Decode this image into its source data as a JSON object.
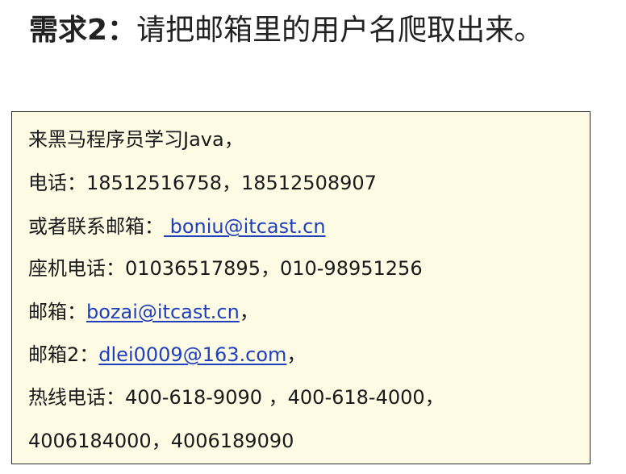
{
  "heading": {
    "label": "需求2：",
    "text": "请把邮箱里的用户名爬取出来。"
  },
  "card": {
    "lines": [
      {
        "text": "来黑马程序员学习Java，"
      },
      {
        "text": "电话：18512516758，18512508907"
      },
      {
        "prefix": "或者联系邮箱：",
        "link": " boniu@itcast.cn",
        "suffix": ""
      },
      {
        "text": "座机电话：01036517895，010-98951256"
      },
      {
        "prefix": "邮箱：",
        "link": "bozai@itcast.cn",
        "suffix": "，"
      },
      {
        "prefix": "邮箱2：",
        "link": "dlei0009@163.com",
        "suffix": "，"
      },
      {
        "text": "热线电话：400-618-9090 ，400-618-4000，"
      },
      {
        "text": "4006184000，4006189090"
      }
    ]
  },
  "colors": {
    "card_background": "#fefbe5",
    "link": "#1f3fbf",
    "border": "#2a2a2a"
  }
}
